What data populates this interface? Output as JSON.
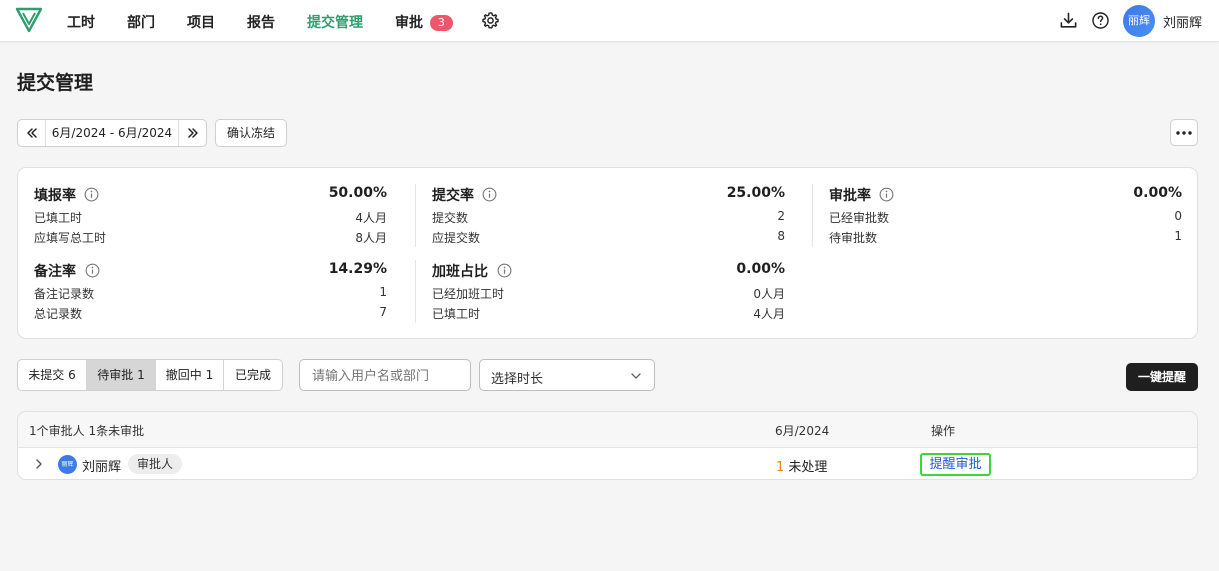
{
  "nav": {
    "items": [
      "工时",
      "部门",
      "项目",
      "报告",
      "提交管理",
      "审批"
    ],
    "active": "提交管理",
    "approval_badge": "3"
  },
  "user": {
    "avatar_text": "丽辉",
    "name": "刘丽辉"
  },
  "page": {
    "title": "提交管理"
  },
  "toolbar": {
    "date_range": "6月/2024 - 6月/2024",
    "confirm_freeze_label": "确认冻结"
  },
  "stats": [
    {
      "name": "填报率",
      "percent": "50.00%",
      "rows": [
        {
          "label": "已填工时",
          "value": "4人月"
        },
        {
          "label": "应填写总工时",
          "value": "8人月"
        }
      ]
    },
    {
      "name": "提交率",
      "percent": "25.00%",
      "rows": [
        {
          "label": "提交数",
          "value": "2"
        },
        {
          "label": "应提交数",
          "value": "8"
        }
      ]
    },
    {
      "name": "审批率",
      "percent": "0.00%",
      "rows": [
        {
          "label": "已经审批数",
          "value": "0"
        },
        {
          "label": "待审批数",
          "value": "1"
        }
      ]
    },
    {
      "name": "备注率",
      "percent": "14.29%",
      "rows": [
        {
          "label": "备注记录数",
          "value": "1"
        },
        {
          "label": "总记录数",
          "value": "7"
        }
      ]
    },
    {
      "name": "加班占比",
      "percent": "0.00%",
      "rows": [
        {
          "label": "已经加班工时",
          "value": "0人月"
        },
        {
          "label": "已填工时",
          "value": "4人月"
        }
      ]
    }
  ],
  "filters": {
    "tabs": [
      {
        "label": "未提交 6",
        "active": false
      },
      {
        "label": "待审批 1",
        "active": true
      },
      {
        "label": "撤回中 1",
        "active": false
      },
      {
        "label": "已完成",
        "active": false
      }
    ],
    "search_placeholder": "请输入用户名或部门",
    "duration_placeholder": "选择时长",
    "remind_all_label": "一键提醒"
  },
  "table": {
    "headers": {
      "summary": "1个审批人 1条未审批",
      "period": "6月/2024",
      "action": "操作"
    },
    "rows": [
      {
        "avatar_text": "丽辉",
        "name": "刘丽辉",
        "role": "审批人",
        "count": "1",
        "status": "未处理",
        "action": "提醒审批"
      }
    ]
  },
  "colors": {
    "accent": "#2f9e6e",
    "badge": "#f0566b",
    "avatar": "#3b7be8",
    "link": "#1e5bd6",
    "highlight": "#3ed43a",
    "count": "#e08a1e"
  }
}
